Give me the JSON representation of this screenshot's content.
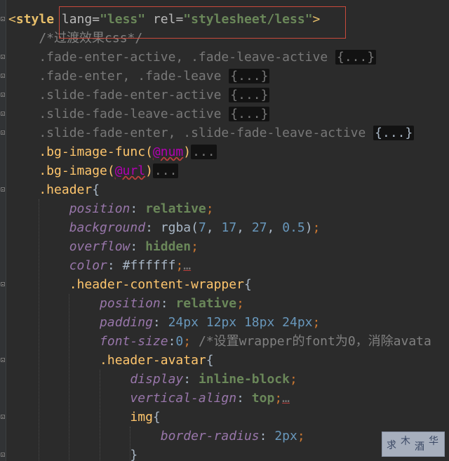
{
  "editor": {
    "lines": [
      {
        "segments": [
          {
            "t": "<",
            "c": "tag-bracket"
          },
          {
            "t": "style",
            "c": "kw-tag"
          },
          {
            "t": " ",
            "c": "plain"
          },
          {
            "t": "lang=",
            "c": "attr"
          },
          {
            "t": "\"less\"",
            "c": "str"
          },
          {
            "t": " ",
            "c": "plain"
          },
          {
            "t": "rel=",
            "c": "attr"
          },
          {
            "t": "\"stylesheet/less\"",
            "c": "str"
          },
          {
            "t": ">",
            "c": "tag-bracket"
          }
        ]
      },
      {
        "segments": [
          {
            "t": "    /*过渡效果css*/",
            "c": "comment"
          }
        ]
      },
      {
        "segments": [
          {
            "t": "    .fade-enter-active, .fade-leave-active ",
            "c": "dim"
          },
          {
            "t": "{...}",
            "c": "fold-box"
          }
        ]
      },
      {
        "segments": [
          {
            "t": "    .fade-enter, .fade-leave ",
            "c": "dim"
          },
          {
            "t": "{...}",
            "c": "fold-box"
          }
        ]
      },
      {
        "segments": [
          {
            "t": "    .slide-fade-enter-active ",
            "c": "dim"
          },
          {
            "t": "{...}",
            "c": "fold-box"
          }
        ]
      },
      {
        "segments": [
          {
            "t": "    .slide-fade-leave-active ",
            "c": "dim"
          },
          {
            "t": "{...}",
            "c": "fold-box"
          }
        ]
      },
      {
        "segments": [
          {
            "t": "    .slide-fade-enter, .slide-fade-leave-active ",
            "c": "dim"
          },
          {
            "t": "{...}",
            "c": "fold-box-bright"
          }
        ]
      },
      {
        "segments": [
          {
            "t": "    .bg-image-func(",
            "c": "sel"
          },
          {
            "t": "@num",
            "c": "var"
          },
          {
            "t": ")",
            "c": "sel"
          },
          {
            "t": "...",
            "c": "fold-box"
          }
        ]
      },
      {
        "segments": [
          {
            "t": "    .bg-image(",
            "c": "sel"
          },
          {
            "t": "@url",
            "c": "var"
          },
          {
            "t": ")",
            "c": "sel"
          },
          {
            "t": "...",
            "c": "fold-box"
          }
        ]
      },
      {
        "segments": [
          {
            "t": "    .header",
            "c": "sel"
          },
          {
            "t": "{",
            "c": "plain"
          }
        ]
      },
      {
        "segments": [
          {
            "t": "        position",
            "c": "prop"
          },
          {
            "t": ": ",
            "c": "plain"
          },
          {
            "t": "relative",
            "c": "val"
          },
          {
            "t": ";",
            "c": "punc"
          }
        ]
      },
      {
        "segments": [
          {
            "t": "        background",
            "c": "prop"
          },
          {
            "t": ": ",
            "c": "plain"
          },
          {
            "t": "rgba(",
            "c": "plain"
          },
          {
            "t": "7",
            "c": "num"
          },
          {
            "t": ", ",
            "c": "plain"
          },
          {
            "t": "17",
            "c": "num"
          },
          {
            "t": ", ",
            "c": "plain"
          },
          {
            "t": "27",
            "c": "num"
          },
          {
            "t": ", ",
            "c": "plain"
          },
          {
            "t": "0.5",
            "c": "num"
          },
          {
            "t": ")",
            "c": "plain"
          },
          {
            "t": ";",
            "c": "punc"
          }
        ]
      },
      {
        "segments": [
          {
            "t": "        overflow",
            "c": "prop"
          },
          {
            "t": ": ",
            "c": "plain"
          },
          {
            "t": "hidden",
            "c": "val"
          },
          {
            "t": ";",
            "c": "punc"
          }
        ]
      },
      {
        "segments": [
          {
            "t": "        color",
            "c": "prop"
          },
          {
            "t": ": ",
            "c": "plain"
          },
          {
            "t": "#ffffff",
            "c": "plain"
          },
          {
            "t": ";",
            "c": "punc"
          },
          {
            "t": "…",
            "c": "dots"
          }
        ]
      },
      {
        "segments": [
          {
            "t": "        .header-content-wrapper",
            "c": "sel"
          },
          {
            "t": "{",
            "c": "plain"
          }
        ]
      },
      {
        "segments": [
          {
            "t": "            position",
            "c": "prop"
          },
          {
            "t": ": ",
            "c": "plain"
          },
          {
            "t": "relative",
            "c": "val"
          },
          {
            "t": ";",
            "c": "punc"
          }
        ]
      },
      {
        "segments": [
          {
            "t": "            padding",
            "c": "prop"
          },
          {
            "t": ": ",
            "c": "plain"
          },
          {
            "t": "24px 12px 18px 24px",
            "c": "num"
          },
          {
            "t": ";",
            "c": "punc"
          }
        ]
      },
      {
        "segments": [
          {
            "t": "            font-size",
            "c": "prop"
          },
          {
            "t": ":",
            "c": "plain"
          },
          {
            "t": "0",
            "c": "num"
          },
          {
            "t": ";",
            "c": "punc"
          },
          {
            "t": " /*设置wrapper的font为0，消除avata",
            "c": "comment"
          }
        ]
      },
      {
        "segments": [
          {
            "t": "            .header-avatar",
            "c": "sel"
          },
          {
            "t": "{",
            "c": "plain"
          }
        ]
      },
      {
        "segments": [
          {
            "t": "                display",
            "c": "prop"
          },
          {
            "t": ": ",
            "c": "plain"
          },
          {
            "t": "inline-block",
            "c": "val"
          },
          {
            "t": ";",
            "c": "punc"
          }
        ]
      },
      {
        "segments": [
          {
            "t": "                vertical-align",
            "c": "prop"
          },
          {
            "t": ": ",
            "c": "plain"
          },
          {
            "t": "top",
            "c": "val"
          },
          {
            "t": ";",
            "c": "punc"
          },
          {
            "t": "…",
            "c": "dots"
          }
        ]
      },
      {
        "segments": [
          {
            "t": "                img",
            "c": "sel"
          },
          {
            "t": "{",
            "c": "plain"
          }
        ]
      },
      {
        "segments": [
          {
            "t": "                    border-radius",
            "c": "prop"
          },
          {
            "t": ": ",
            "c": "plain"
          },
          {
            "t": "2px",
            "c": "num"
          },
          {
            "t": ";",
            "c": "punc"
          }
        ]
      },
      {
        "segments": [
          {
            "t": "                }",
            "c": "plain"
          }
        ]
      }
    ],
    "fold_markers_at_lines": [
      0,
      2,
      3,
      4,
      5,
      6,
      9,
      14,
      18,
      21,
      23
    ],
    "highlight_box_line": 0
  },
  "watermark": {
    "chars": [
      "求",
      "木",
      "酒",
      "华"
    ]
  }
}
